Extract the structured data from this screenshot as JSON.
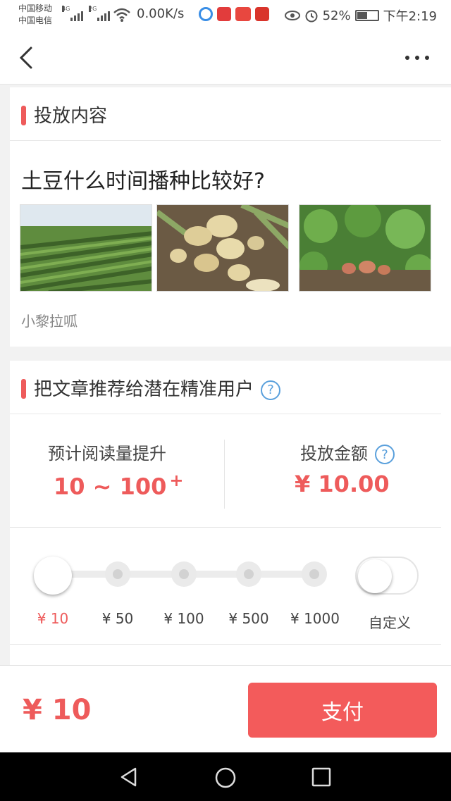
{
  "status_bar": {
    "carrier_1": "中国移动",
    "carrier_2": "中国电信",
    "net_1": "4G",
    "net_2": "2G",
    "speed": "0.00K/s",
    "battery": "52%",
    "time": "下午2:19"
  },
  "header": {
    "back_icon": "chevron-left-icon",
    "more_icon": "more-dots-icon"
  },
  "content_section": {
    "title": "投放内容",
    "article_title": "土豆什么时间播种比较好?",
    "author": "小黎拉呱",
    "images": [
      "potato-field",
      "harvested-potatoes",
      "potato-plants"
    ]
  },
  "promote_section": {
    "title": "把文章推荐给潜在精准用户",
    "help_icon": "?",
    "reads_label": "预计阅读量提升",
    "reads_value": "10 ~ 100",
    "reads_plus": "+",
    "amount_label": "投放金额",
    "amount_help": "?",
    "amount_value": "¥ 10.00"
  },
  "amount_options": {
    "options": [
      "¥ 10",
      "¥ 50",
      "¥ 100",
      "¥ 500",
      "¥ 1000"
    ],
    "selected_index": 0,
    "custom_label": "自定义",
    "custom_enabled": false
  },
  "pay_bar": {
    "total": "¥ 10",
    "pay_label": "支付"
  },
  "colors": {
    "accent": "#ee5b5b",
    "pay_button": "#f35b5b",
    "help_blue": "#5aa0dc"
  }
}
